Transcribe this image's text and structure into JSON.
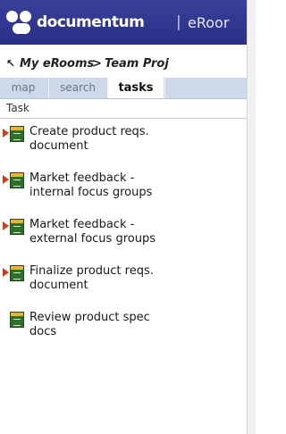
{
  "header": {
    "brand": "documentum",
    "separator": "|",
    "product": "eRoor"
  },
  "breadcrumb": {
    "arrow": "↖",
    "crumb1": "My eRooms",
    "separator": ">",
    "crumb2": "Team Proj"
  },
  "tabs": [
    {
      "label": "map",
      "active": false
    },
    {
      "label": "search",
      "active": false
    },
    {
      "label": "tasks",
      "active": true
    },
    {
      "label": "",
      "active": false
    }
  ],
  "list": {
    "column_header": "Task",
    "items": [
      {
        "line1": "Create product reqs.",
        "line2": "document",
        "flagged": true
      },
      {
        "line1": "Market feedback -",
        "line2": "internal focus groups",
        "flagged": true
      },
      {
        "line1": "Market feedback -",
        "line2": "external focus groups",
        "flagged": true
      },
      {
        "line1": "Finalize product reqs.",
        "line2": "document",
        "flagged": true
      },
      {
        "line1": "Review product spec",
        "line2": "docs",
        "flagged": false
      }
    ]
  },
  "colors": {
    "header_bg": "#2a2f86",
    "tabbar_bg": "#cdd8e8",
    "flag": "#d23a1e",
    "task_icon": "#2f6e2b"
  },
  "icons": {
    "logo": "documentum-logo-icon",
    "flag": "priority-flag-icon",
    "task": "task-icon",
    "breadcrumb": "up-arrow-icon"
  }
}
